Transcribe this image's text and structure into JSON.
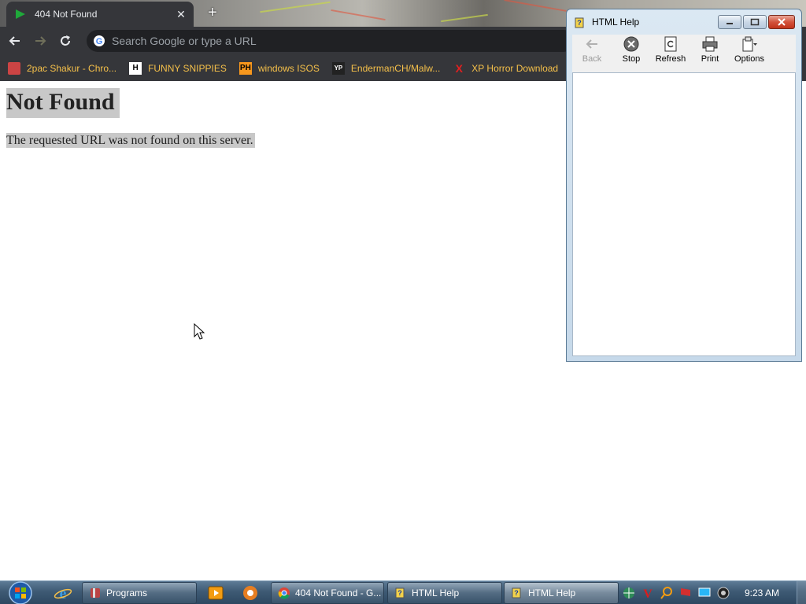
{
  "browser": {
    "tab": {
      "title": "404 Not Found"
    },
    "omnibox": {
      "placeholder": "Search Google or type a URL"
    },
    "bookmarks": [
      {
        "label": "2pac Shakur - Chro...",
        "icon": "tupac-icon"
      },
      {
        "label": "FUNNY SNIPPIES",
        "icon": "h-icon",
        "icon_text": "H"
      },
      {
        "label": "windows ISOS",
        "icon": "ph-icon",
        "icon_text": "PH"
      },
      {
        "label": "EndermanCH/Malw...",
        "icon": "yp-icon",
        "icon_text": "YP"
      },
      {
        "label": "XP Horror Download",
        "icon": "x-icon",
        "icon_text": "X"
      }
    ],
    "page": {
      "heading": "Not Found",
      "message": "The requested URL was not found on this server."
    }
  },
  "help_window": {
    "title": "HTML Help",
    "toolbar": {
      "back": "Back",
      "stop": "Stop",
      "refresh": "Refresh",
      "print": "Print",
      "options": "Options"
    }
  },
  "taskbar": {
    "tasks": [
      {
        "label": "Programs"
      },
      {
        "label": "404 Not Found - G..."
      },
      {
        "label": "HTML Help"
      },
      {
        "label": "HTML Help"
      }
    ],
    "clock": "9:23 AM"
  },
  "colors": {
    "chrome_dark": "#35363a",
    "bookmark_text": "#f5c04a",
    "highlight": "#c8c8c8",
    "help_frame": "#c6d9ea",
    "taskbar": "#3e5a74"
  }
}
